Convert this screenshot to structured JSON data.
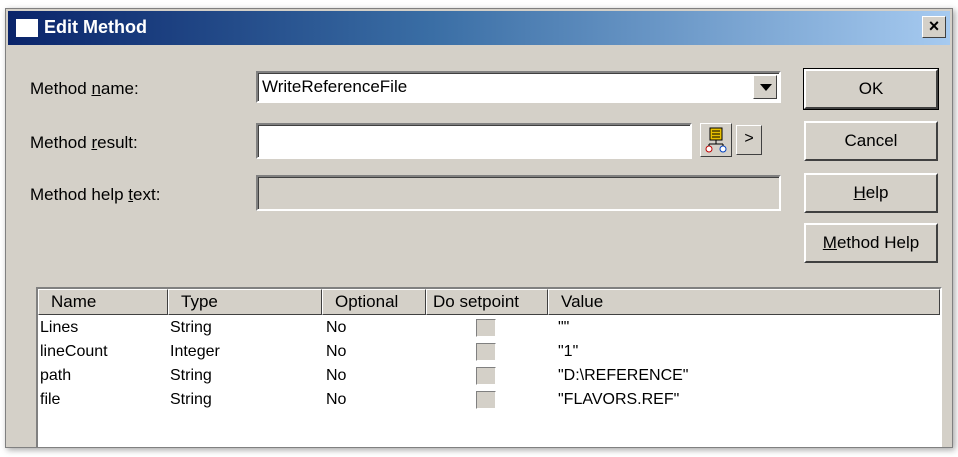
{
  "window": {
    "title": "Edit Method",
    "close_label": "×"
  },
  "labels": {
    "method_name": {
      "pre": "Method ",
      "u": "n",
      "post": "ame:"
    },
    "method_result": {
      "pre": "Method ",
      "u": "r",
      "post": "esult:"
    },
    "method_help": {
      "pre": "Method help ",
      "u": "t",
      "post": "ext:"
    }
  },
  "fields": {
    "method_name_value": "WriteReferenceFile",
    "method_result_value": "",
    "method_help_value": ""
  },
  "buttons": {
    "ok": "OK",
    "cancel": "Cancel",
    "help": {
      "u": "H",
      "post": "elp"
    },
    "method_help": {
      "u": "M",
      "post": "ethod Help"
    },
    "arrow": ">"
  },
  "table": {
    "columns": [
      "Name",
      "Type",
      "Optional",
      "Do setpoint",
      "Value"
    ],
    "rows": [
      {
        "name": "Lines",
        "type": "String",
        "optional": "No",
        "setpoint": false,
        "value": "\"\""
      },
      {
        "name": "lineCount",
        "type": "Integer",
        "optional": "No",
        "setpoint": false,
        "value": "\"1\""
      },
      {
        "name": "path",
        "type": "String",
        "optional": "No",
        "setpoint": false,
        "value": "\"D:\\REFERENCE\""
      },
      {
        "name": "file",
        "type": "String",
        "optional": "No",
        "setpoint": false,
        "value": "\"FLAVORS.REF\""
      }
    ]
  }
}
